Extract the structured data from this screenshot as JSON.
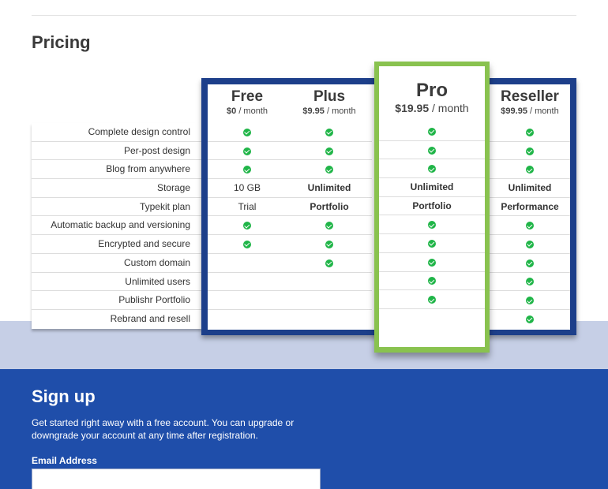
{
  "section": {
    "title": "Pricing"
  },
  "features": [
    "Complete design control",
    "Per-post design",
    "Blog from anywhere",
    "Storage",
    "Typekit plan",
    "Automatic backup and versioning",
    "Encrypted and secure",
    "Custom domain",
    "Unlimited users",
    "Publishr Portfolio",
    "Rebrand and resell"
  ],
  "plans": {
    "free": {
      "name": "Free",
      "price": "$0",
      "period": "/ month",
      "cells": [
        "check",
        "check",
        "check",
        "10 GB",
        "Trial",
        "check",
        "check",
        "",
        "",
        "",
        ""
      ]
    },
    "plus": {
      "name": "Plus",
      "price": "$9.95",
      "period": "/ month",
      "cells": [
        "check",
        "check",
        "check",
        "Unlimited",
        "Portfolio",
        "check",
        "check",
        "check",
        "",
        "",
        ""
      ]
    },
    "pro": {
      "name": "Pro",
      "price": "$19.95",
      "period": "/ month",
      "cells": [
        "check",
        "check",
        "check",
        "Unlimited",
        "Portfolio",
        "check",
        "check",
        "check",
        "check",
        "check",
        ""
      ]
    },
    "reseller": {
      "name": "Reseller",
      "price": "$99.95",
      "period": "/ month",
      "cells": [
        "check",
        "check",
        "check",
        "Unlimited",
        "Performance",
        "check",
        "check",
        "check",
        "check",
        "check",
        "check"
      ]
    }
  },
  "icons": {
    "check": "check-circle-icon"
  },
  "colors": {
    "frame_blue": "#1d3f8a",
    "pro_green": "#89c24f",
    "check_green": "#20b548",
    "signup_blue": "#1f4eaa",
    "band_light": "#c6cfe6"
  },
  "signup": {
    "title": "Sign up",
    "description": "Get started right away with a free account. You can upgrade or downgrade your account at any time after registration.",
    "email_label": "Email Address",
    "email_value": ""
  }
}
